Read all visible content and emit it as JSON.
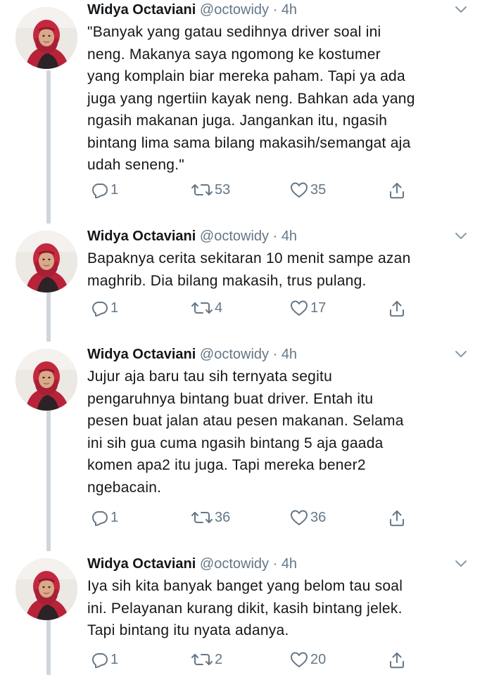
{
  "tweets": [
    {
      "name": "Widya Octaviani",
      "handle": "@octowidy",
      "time_sep": "·",
      "time": "4h",
      "text": "\"Banyak yang gatau sedihnya driver soal ini\nneng. Makanya saya ngomong ke kostumer\nyang komplain biar mereka paham. Tapi ya ada\njuga yang ngertiin kayak neng. Bahkan ada yang\nngasih makanan juga. Jangankan itu, ngasih\nbintang lima sama bilang makasih/semangat aja\nudah seneng.\"",
      "replies": "1",
      "retweets": "53",
      "likes": "35"
    },
    {
      "name": "Widya Octaviani",
      "handle": "@octowidy",
      "time_sep": "·",
      "time": "4h",
      "text": "Bapaknya cerita sekitaran 10 menit sampe azan\nmaghrib. Dia bilang makasih, trus pulang.",
      "replies": "1",
      "retweets": "4",
      "likes": "17"
    },
    {
      "name": "Widya Octaviani",
      "handle": "@octowidy",
      "time_sep": "·",
      "time": "4h",
      "text": "Jujur aja baru tau sih ternyata segitu\npengaruhnya bintang buat driver. Entah itu\npesen buat jalan atau pesen makanan. Selama\nini sih gua cuma ngasih bintang 5 aja gaada\nkomen apa2 itu juga. Tapi mereka bener2\nngebacain.",
      "replies": "1",
      "retweets": "36",
      "likes": "36"
    },
    {
      "name": "Widya Octaviani",
      "handle": "@octowidy",
      "time_sep": "·",
      "time": "4h",
      "text": "Iya sih kita banyak banget yang belom tau soal\nini. Pelayanan kurang dikit, kasih bintang jelek.\nTapi bintang itu nyata adanya.",
      "replies": "1",
      "retweets": "2",
      "likes": "20"
    }
  ],
  "icons": {
    "reply": "reply-icon",
    "retweet": "retweet-icon",
    "like": "heart-icon",
    "share": "share-icon",
    "caret": "chevron-down-icon"
  },
  "colors": {
    "text": "#14171a",
    "secondary": "#657786",
    "thread_line": "#d0d6dc",
    "avatar_hijab": "#b8233a"
  }
}
